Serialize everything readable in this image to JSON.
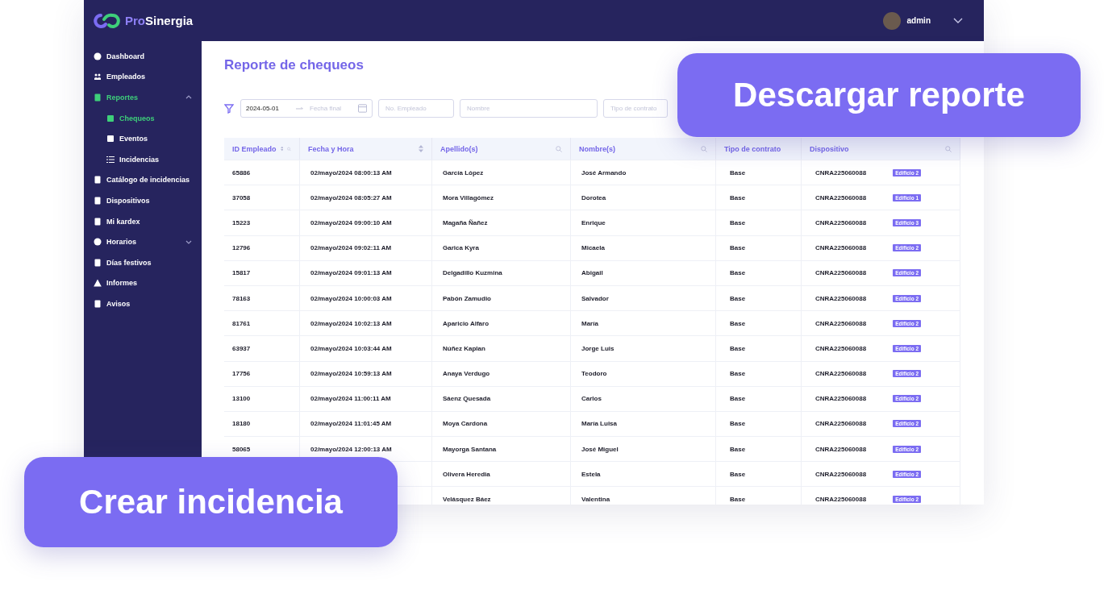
{
  "topbar": {
    "logo": {
      "prefix": "Pro",
      "name": "Sinergia"
    },
    "user": {
      "name": "admin"
    }
  },
  "sidebar": {
    "items": [
      {
        "label": "Dashboard",
        "selected": false
      },
      {
        "label": "Empleados",
        "selected": false
      },
      {
        "label": "Reportes",
        "selected": false,
        "active": true,
        "expanded": true,
        "children": [
          {
            "label": "Chequeos",
            "selected": true
          },
          {
            "label": "Eventos",
            "selected": false
          },
          {
            "label": "Incidencias",
            "selected": false
          }
        ]
      },
      {
        "label": "Catálogo de incidencias",
        "selected": false
      },
      {
        "label": "Dispositivos",
        "selected": false
      },
      {
        "label": "Mi kardex",
        "selected": false
      },
      {
        "label": "Horarios",
        "selected": false,
        "expanded": false
      },
      {
        "label": "Días festivos",
        "selected": false
      },
      {
        "label": "Informes",
        "selected": false
      },
      {
        "label": "Avisos",
        "selected": false
      }
    ]
  },
  "page": {
    "title": "Reporte de chequeos"
  },
  "filters": {
    "date_start": "2024-05-01",
    "date_end_placeholder": "Fecha final",
    "fields": [
      {
        "placeholder": "No. Empleado"
      },
      {
        "placeholder": "Nombre"
      },
      {
        "placeholder": "Tipo de contrato"
      }
    ]
  },
  "table": {
    "columns": [
      {
        "label": "ID Empleado",
        "sortable": true,
        "searchable": true
      },
      {
        "label": "Fecha y Hora",
        "sortable": true,
        "searchable": false
      },
      {
        "label": "Apellido(s)",
        "sortable": false,
        "searchable": true
      },
      {
        "label": "Nombre(s)",
        "sortable": false,
        "searchable": true
      },
      {
        "label": "Tipo de contrato",
        "sortable": false,
        "searchable": false
      },
      {
        "label": "Dispositivo",
        "sortable": false,
        "searchable": true
      }
    ],
    "rows": [
      {
        "id": "65886",
        "datetime": "02/mayo/2024 08:00:13 AM",
        "surname": "García López",
        "name": "José Armando",
        "contract": "Base",
        "device": "CNRA225060088",
        "building": "Edificio 2"
      },
      {
        "id": "37058",
        "datetime": "02/mayo/2024 08:05:27 AM",
        "surname": "Mora Villagómez",
        "name": "Dorotea",
        "contract": "Base",
        "device": "CNRA225060088",
        "building": "Edificio 1"
      },
      {
        "id": "15223",
        "datetime": "02/mayo/2024 09:00:10 AM",
        "surname": "Magaña Ñañez",
        "name": "Enrique",
        "contract": "Base",
        "device": "CNRA225060088",
        "building": "Edificio 3"
      },
      {
        "id": "12796",
        "datetime": "02/mayo/2024 09:02:11 AM",
        "surname": "Garica Kyra",
        "name": "Micaela",
        "contract": "Base",
        "device": "CNRA225060088",
        "building": "Edificio 2"
      },
      {
        "id": "15817",
        "datetime": "02/mayo/2024 09:01:13 AM",
        "surname": "Delgadillo Kuzmina",
        "name": "Abigail",
        "contract": "Base",
        "device": "CNRA225060088",
        "building": "Edificio 2"
      },
      {
        "id": "78163",
        "datetime": "02/mayo/2024 10:00:03 AM",
        "surname": "Pabón Zamudio",
        "name": "Salvador",
        "contract": "Base",
        "device": "CNRA225060088",
        "building": "Edificio 2"
      },
      {
        "id": "81761",
        "datetime": "02/mayo/2024 10:02:13 AM",
        "surname": "Aparicio Alfaro",
        "name": "María",
        "contract": "Base",
        "device": "CNRA225060088",
        "building": "Edificio 2"
      },
      {
        "id": "63937",
        "datetime": "02/mayo/2024 10:03:44 AM",
        "surname": "Núñez Kaplan",
        "name": "Jorge Luis",
        "contract": "Base",
        "device": "CNRA225060088",
        "building": "Edificio 2"
      },
      {
        "id": "17756",
        "datetime": "02/mayo/2024 10:59:13 AM",
        "surname": "Anaya Verdugo",
        "name": "Teodoro",
        "contract": "Base",
        "device": "CNRA225060088",
        "building": "Edificio 2"
      },
      {
        "id": "13100",
        "datetime": "02/mayo/2024 11:00:11 AM",
        "surname": "Sáenz Quesada",
        "name": "Carlos",
        "contract": "Base",
        "device": "CNRA225060088",
        "building": "Edificio 2"
      },
      {
        "id": "18180",
        "datetime": "02/mayo/2024 11:01:45 AM",
        "surname": "Moya Cardona",
        "name": "María Luisa",
        "contract": "Base",
        "device": "CNRA225060088",
        "building": "Edificio 2"
      },
      {
        "id": "58065",
        "datetime": "02/mayo/2024 12:00:13 AM",
        "surname": "Mayorga Santana",
        "name": "José Miguel",
        "contract": "Base",
        "device": "CNRA225060088",
        "building": "Edificio 2"
      },
      {
        "surname": "Olivera Heredia",
        "name": "Estela",
        "contract": "Base",
        "device": "CNRA225060088",
        "building": "Edificio 2"
      },
      {
        "surname": "Velásquez Báez",
        "name": "Valentina",
        "contract": "Base",
        "device": "CNRA225060088",
        "building": "Edificio 2"
      }
    ]
  },
  "callouts": [
    {
      "label": "Descargar reporte",
      "kind": "top"
    },
    {
      "label": "Crear incidencia",
      "kind": "bottom"
    }
  ]
}
